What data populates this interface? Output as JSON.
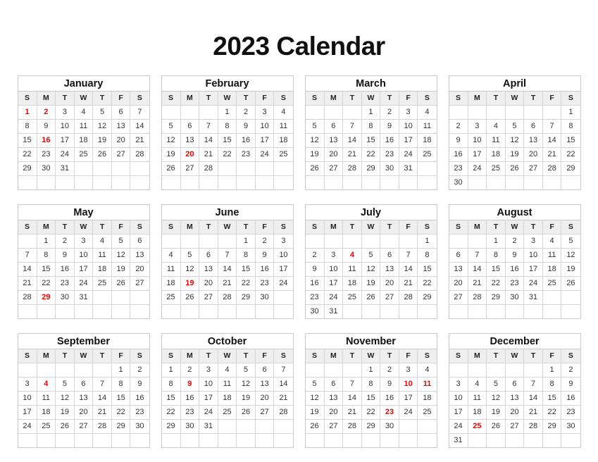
{
  "document": {
    "title": "2023 Calendar",
    "year": "2023"
  },
  "colors": {
    "holiday": "#f60000",
    "text": "#333333",
    "header_background": "#efefef",
    "border": "#d4d4d4",
    "page_background": "#ffffff"
  },
  "weekday_headers": [
    "S",
    "M",
    "T",
    "W",
    "T",
    "F",
    "S"
  ],
  "months": [
    {
      "name": "January",
      "weeks": [
        [
          "1",
          "2",
          "3",
          "4",
          "5",
          "6",
          "7"
        ],
        [
          "8",
          "9",
          "10",
          "11",
          "12",
          "13",
          "14"
        ],
        [
          "15",
          "16",
          "17",
          "18",
          "19",
          "20",
          "21"
        ],
        [
          "22",
          "23",
          "24",
          "25",
          "26",
          "27",
          "28"
        ],
        [
          "29",
          "30",
          "31",
          "",
          "",
          "",
          ""
        ],
        [
          "",
          "",
          "",
          "",
          "",
          "",
          ""
        ]
      ],
      "holidays": [
        "1",
        "2",
        "16"
      ]
    },
    {
      "name": "February",
      "weeks": [
        [
          "",
          "",
          "",
          "1",
          "2",
          "3",
          "4"
        ],
        [
          "5",
          "6",
          "7",
          "8",
          "9",
          "10",
          "11"
        ],
        [
          "12",
          "13",
          "14",
          "15",
          "16",
          "17",
          "18"
        ],
        [
          "19",
          "20",
          "21",
          "22",
          "23",
          "24",
          "25"
        ],
        [
          "26",
          "27",
          "28",
          "",
          "",
          "",
          ""
        ],
        [
          "",
          "",
          "",
          "",
          "",
          "",
          ""
        ]
      ],
      "holidays": [
        "20"
      ]
    },
    {
      "name": "March",
      "weeks": [
        [
          "",
          "",
          "",
          "1",
          "2",
          "3",
          "4"
        ],
        [
          "5",
          "6",
          "7",
          "8",
          "9",
          "10",
          "11"
        ],
        [
          "12",
          "13",
          "14",
          "15",
          "16",
          "17",
          "18"
        ],
        [
          "19",
          "20",
          "21",
          "22",
          "23",
          "24",
          "25"
        ],
        [
          "26",
          "27",
          "28",
          "29",
          "30",
          "31",
          ""
        ],
        [
          "",
          "",
          "",
          "",
          "",
          "",
          ""
        ]
      ],
      "holidays": []
    },
    {
      "name": "April",
      "weeks": [
        [
          "",
          "",
          "",
          "",
          "",
          "",
          "1"
        ],
        [
          "2",
          "3",
          "4",
          "5",
          "6",
          "7",
          "8"
        ],
        [
          "9",
          "10",
          "11",
          "12",
          "13",
          "14",
          "15"
        ],
        [
          "16",
          "17",
          "18",
          "19",
          "20",
          "21",
          "22"
        ],
        [
          "23",
          "24",
          "25",
          "26",
          "27",
          "28",
          "29"
        ],
        [
          "30",
          "",
          "",
          "",
          "",
          "",
          ""
        ]
      ],
      "holidays": []
    },
    {
      "name": "May",
      "weeks": [
        [
          "",
          "1",
          "2",
          "3",
          "4",
          "5",
          "6"
        ],
        [
          "7",
          "8",
          "9",
          "10",
          "11",
          "12",
          "13"
        ],
        [
          "14",
          "15",
          "16",
          "17",
          "18",
          "19",
          "20"
        ],
        [
          "21",
          "22",
          "23",
          "24",
          "25",
          "26",
          "27"
        ],
        [
          "28",
          "29",
          "30",
          "31",
          "",
          "",
          ""
        ],
        [
          "",
          "",
          "",
          "",
          "",
          "",
          ""
        ]
      ],
      "holidays": [
        "29"
      ]
    },
    {
      "name": "June",
      "weeks": [
        [
          "",
          "",
          "",
          "",
          "1",
          "2",
          "3"
        ],
        [
          "4",
          "5",
          "6",
          "7",
          "8",
          "9",
          "10"
        ],
        [
          "11",
          "12",
          "13",
          "14",
          "15",
          "16",
          "17"
        ],
        [
          "18",
          "19",
          "20",
          "21",
          "22",
          "23",
          "24"
        ],
        [
          "25",
          "26",
          "27",
          "28",
          "29",
          "30",
          ""
        ],
        [
          "",
          "",
          "",
          "",
          "",
          "",
          ""
        ]
      ],
      "holidays": [
        "19"
      ]
    },
    {
      "name": "July",
      "weeks": [
        [
          "",
          "",
          "",
          "",
          "",
          "",
          "1"
        ],
        [
          "2",
          "3",
          "4",
          "5",
          "6",
          "7",
          "8"
        ],
        [
          "9",
          "10",
          "11",
          "12",
          "13",
          "14",
          "15"
        ],
        [
          "16",
          "17",
          "18",
          "19",
          "20",
          "21",
          "22"
        ],
        [
          "23",
          "24",
          "25",
          "26",
          "27",
          "28",
          "29"
        ],
        [
          "30",
          "31",
          "",
          "",
          "",
          "",
          ""
        ]
      ],
      "holidays": [
        "4"
      ]
    },
    {
      "name": "August",
      "weeks": [
        [
          "",
          "",
          "1",
          "2",
          "3",
          "4",
          "5"
        ],
        [
          "6",
          "7",
          "8",
          "9",
          "10",
          "11",
          "12"
        ],
        [
          "13",
          "14",
          "15",
          "16",
          "17",
          "18",
          "19"
        ],
        [
          "20",
          "21",
          "22",
          "23",
          "24",
          "25",
          "26"
        ],
        [
          "27",
          "28",
          "29",
          "30",
          "31",
          "",
          ""
        ],
        [
          "",
          "",
          "",
          "",
          "",
          "",
          ""
        ]
      ],
      "holidays": []
    },
    {
      "name": "September",
      "weeks": [
        [
          "",
          "",
          "",
          "",
          "",
          "1",
          "2"
        ],
        [
          "3",
          "4",
          "5",
          "6",
          "7",
          "8",
          "9"
        ],
        [
          "10",
          "11",
          "12",
          "13",
          "14",
          "15",
          "16"
        ],
        [
          "17",
          "18",
          "19",
          "20",
          "21",
          "22",
          "23"
        ],
        [
          "24",
          "25",
          "26",
          "27",
          "28",
          "29",
          "30"
        ],
        [
          "",
          "",
          "",
          "",
          "",
          "",
          ""
        ]
      ],
      "holidays": [
        "4"
      ]
    },
    {
      "name": "October",
      "weeks": [
        [
          "1",
          "2",
          "3",
          "4",
          "5",
          "6",
          "7"
        ],
        [
          "8",
          "9",
          "10",
          "11",
          "12",
          "13",
          "14"
        ],
        [
          "15",
          "16",
          "17",
          "18",
          "19",
          "20",
          "21"
        ],
        [
          "22",
          "23",
          "24",
          "25",
          "26",
          "27",
          "28"
        ],
        [
          "29",
          "30",
          "31",
          "",
          "",
          "",
          ""
        ],
        [
          "",
          "",
          "",
          "",
          "",
          "",
          ""
        ]
      ],
      "holidays": [
        "9"
      ]
    },
    {
      "name": "November",
      "weeks": [
        [
          "",
          "",
          "",
          "1",
          "2",
          "3",
          "4"
        ],
        [
          "5",
          "6",
          "7",
          "8",
          "9",
          "10",
          "11"
        ],
        [
          "12",
          "13",
          "14",
          "15",
          "16",
          "17",
          "18"
        ],
        [
          "19",
          "20",
          "21",
          "22",
          "23",
          "24",
          "25"
        ],
        [
          "26",
          "27",
          "28",
          "29",
          "30",
          "",
          ""
        ],
        [
          "",
          "",
          "",
          "",
          "",
          "",
          ""
        ]
      ],
      "holidays": [
        "10",
        "11",
        "23"
      ]
    },
    {
      "name": "December",
      "weeks": [
        [
          "",
          "",
          "",
          "",
          "",
          "1",
          "2"
        ],
        [
          "3",
          "4",
          "5",
          "6",
          "7",
          "8",
          "9"
        ],
        [
          "10",
          "11",
          "12",
          "13",
          "14",
          "15",
          "16"
        ],
        [
          "17",
          "18",
          "19",
          "20",
          "21",
          "22",
          "23"
        ],
        [
          "24",
          "25",
          "26",
          "27",
          "28",
          "29",
          "30"
        ],
        [
          "31",
          "",
          "",
          "",
          "",
          "",
          ""
        ]
      ],
      "holidays": [
        "25"
      ]
    }
  ]
}
